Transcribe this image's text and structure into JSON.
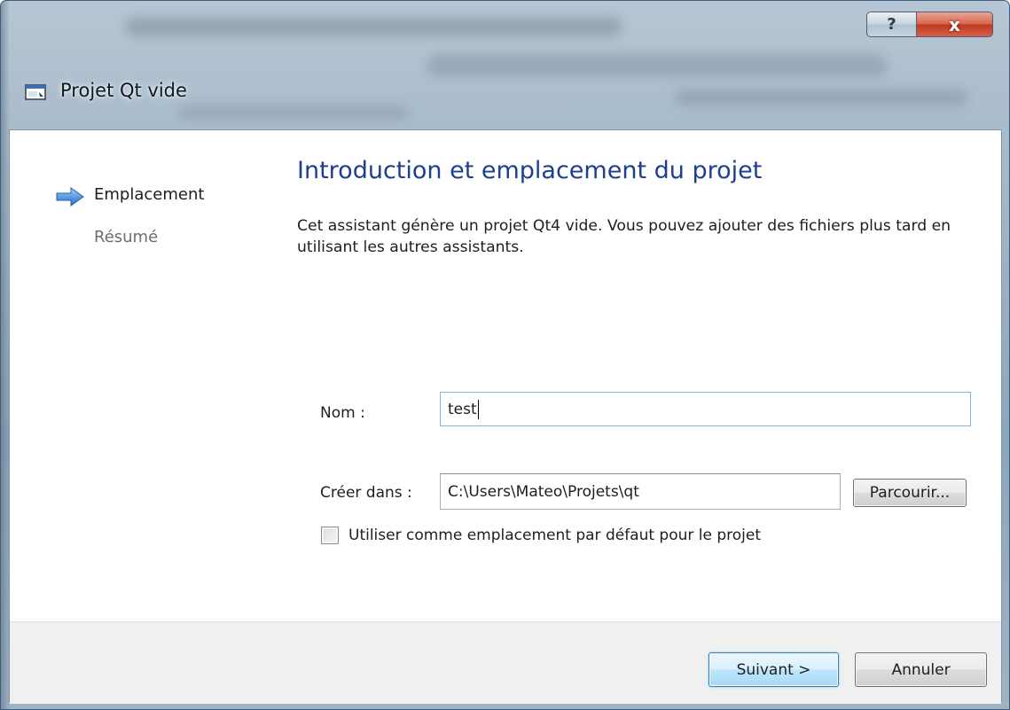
{
  "window": {
    "title": "Projet Qt vide",
    "icon": "window-app-icon",
    "caption_buttons": {
      "help_label": "?",
      "close_label": "x"
    }
  },
  "steps": {
    "items": [
      {
        "label": "Emplacement",
        "state": "current"
      },
      {
        "label": "Résumé",
        "state": "pending"
      }
    ],
    "current_indicator_icon": "arrow-right-icon"
  },
  "page": {
    "title": "Introduction et emplacement du projet",
    "description": "Cet assistant génère un projet Qt4 vide. Vous pouvez ajouter des fichiers plus tard en utilisant les autres assistants."
  },
  "form": {
    "name_label": "Nom :",
    "name_value": "test",
    "location_label": "Créer dans :",
    "location_value": "C:\\Users\\Mateo\\Projets\\qt",
    "browse_label": "Parcourir...",
    "default_location_checkbox": {
      "label": "Utiliser comme emplacement par défaut pour le projet",
      "checked": false
    }
  },
  "footer": {
    "next_label": "Suivant >",
    "cancel_label": "Annuler"
  },
  "colors": {
    "title_accent": "#1d3f8f",
    "close_button": "#c0391e",
    "focus_border": "#7eb4ea"
  }
}
